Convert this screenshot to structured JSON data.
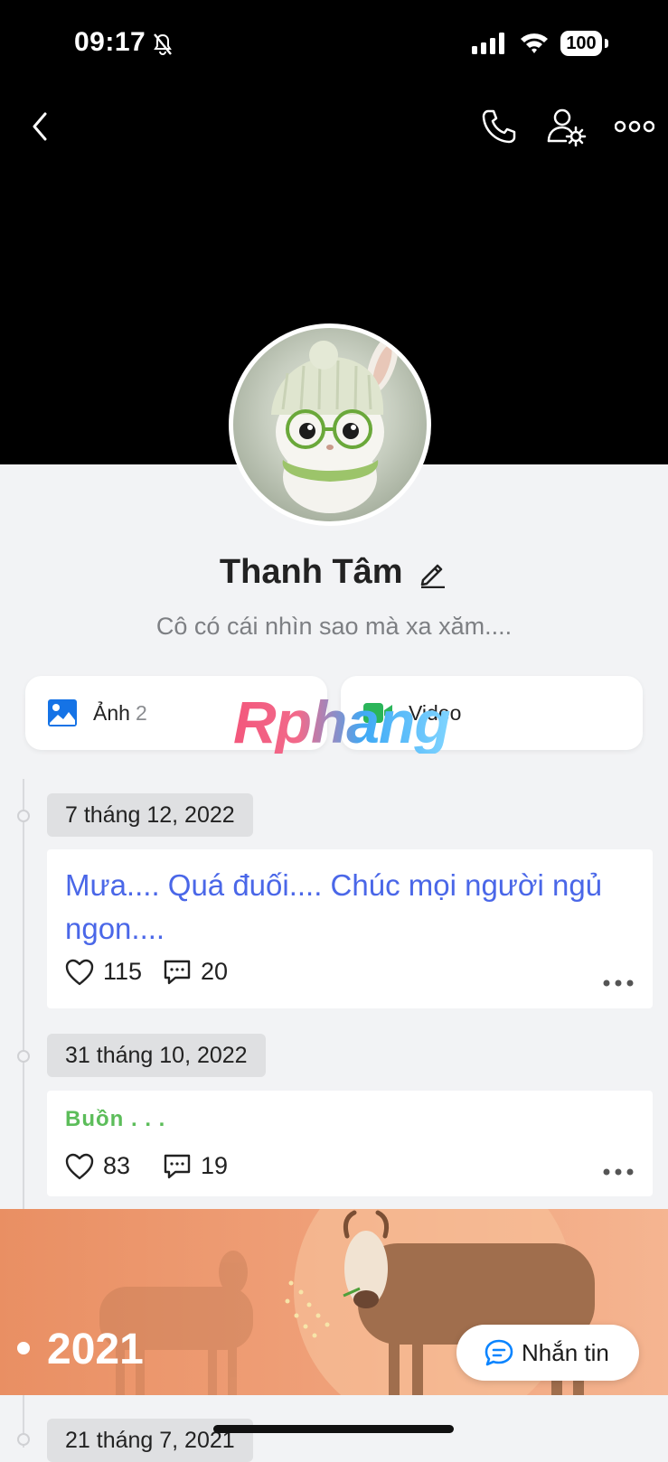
{
  "status_bar": {
    "time": "09:17",
    "battery": "100"
  },
  "profile": {
    "name": "Thanh Tâm",
    "bio": "Cô có cái nhìn sao mà xa xăm...."
  },
  "tiles": {
    "photos_label": "Ảnh",
    "photos_count": "2",
    "video_label": "Video"
  },
  "watermark": "Rphang",
  "timeline": {
    "posts": [
      {
        "date": "7 tháng 12, 2022",
        "text": "Mưa.... Quá đuối.... Chúc mọi người ngủ ngon....",
        "likes": "115",
        "comments": "20"
      },
      {
        "date": "31 tháng 10, 2022",
        "text": "Buồn . . .",
        "likes": "83",
        "comments": "19"
      }
    ],
    "year_banner": "2021",
    "next_date": "21 tháng 7, 2021"
  },
  "chat_button": {
    "label": "Nhắn tin"
  },
  "colors": {
    "post_blue": "#4a67e8",
    "post_green": "#5cbd5a",
    "accent": "#0a84ff"
  }
}
